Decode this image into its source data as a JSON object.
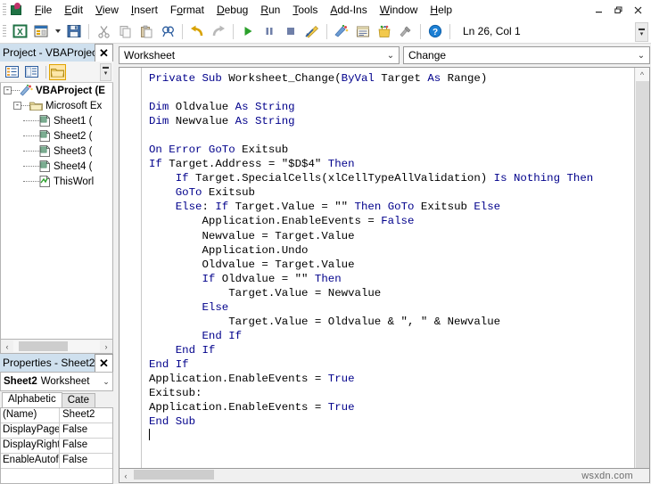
{
  "app": {
    "logo_icon": "excel-vba-logo-icon",
    "window_controls": {
      "minimize": "–",
      "restore": "❐",
      "close": "✕"
    }
  },
  "menubar": {
    "items": [
      {
        "label": "File",
        "accel": "F"
      },
      {
        "label": "Edit",
        "accel": "E"
      },
      {
        "label": "View",
        "accel": "V"
      },
      {
        "label": "Insert",
        "accel": "I"
      },
      {
        "label": "Format",
        "accel": "o"
      },
      {
        "label": "Debug",
        "accel": "D"
      },
      {
        "label": "Run",
        "accel": "R"
      },
      {
        "label": "Tools",
        "accel": "T"
      },
      {
        "label": "Add-Ins",
        "accel": "A"
      },
      {
        "label": "Window",
        "accel": "W"
      },
      {
        "label": "Help",
        "accel": "H"
      }
    ]
  },
  "toolbar": {
    "buttons": [
      {
        "name": "view-excel-icon",
        "title": "View Microsoft Excel"
      },
      {
        "name": "insert-userform-icon",
        "title": "Insert UserForm"
      },
      {
        "name": "save-icon",
        "title": "Save"
      },
      {
        "name": "cut-icon",
        "title": "Cut"
      },
      {
        "name": "copy-icon",
        "title": "Copy"
      },
      {
        "name": "paste-icon",
        "title": "Paste"
      },
      {
        "name": "find-icon",
        "title": "Find"
      },
      {
        "name": "undo-icon",
        "title": "Undo"
      },
      {
        "name": "redo-icon",
        "title": "Redo"
      },
      {
        "name": "run-icon",
        "title": "Run Sub/UserForm"
      },
      {
        "name": "break-icon",
        "title": "Break"
      },
      {
        "name": "reset-icon",
        "title": "Reset"
      },
      {
        "name": "design-mode-icon",
        "title": "Design Mode"
      },
      {
        "name": "project-explorer-icon",
        "title": "Project Explorer"
      },
      {
        "name": "properties-window-icon",
        "title": "Properties Window"
      },
      {
        "name": "object-browser-icon",
        "title": "Object Browser"
      },
      {
        "name": "toolbox-icon",
        "title": "Toolbox"
      },
      {
        "name": "help-icon",
        "title": "Microsoft Visual Basic for Applications Help"
      }
    ],
    "position_status": "Ln 26, Col 1"
  },
  "project_explorer": {
    "title": "Project - VBAProjec",
    "close_label": "✕",
    "toolbar": [
      {
        "name": "view-code-icon"
      },
      {
        "name": "view-object-icon"
      },
      {
        "name": "toggle-folders-icon"
      }
    ],
    "tree": [
      {
        "level": 0,
        "icon": "vbaproject-icon",
        "label": "VBAProject (E",
        "bold": true,
        "expander": "-"
      },
      {
        "level": 1,
        "icon": "folder-icon",
        "label": "Microsoft Ex",
        "bold": false,
        "expander": "-"
      },
      {
        "level": 2,
        "icon": "worksheet-icon",
        "label": "Sheet1 (",
        "bold": false,
        "expander": ""
      },
      {
        "level": 2,
        "icon": "worksheet-icon",
        "label": "Sheet2 (",
        "bold": false,
        "expander": ""
      },
      {
        "level": 2,
        "icon": "worksheet-icon",
        "label": "Sheet3 (",
        "bold": false,
        "expander": ""
      },
      {
        "level": 2,
        "icon": "worksheet-icon",
        "label": "Sheet4 (",
        "bold": false,
        "expander": ""
      },
      {
        "level": 2,
        "icon": "thisworkbook-icon",
        "label": "ThisWorl",
        "bold": false,
        "expander": ""
      }
    ],
    "hscroll": {
      "left_arrow": "‹",
      "right_arrow": "›"
    }
  },
  "properties_panel": {
    "title": "Properties - Sheet2",
    "close_label": "✕",
    "object_name": "Sheet2",
    "object_type": "Worksheet",
    "combo_arrow": "⌄",
    "tabs": [
      {
        "label": "Alphabetic",
        "selected": true
      },
      {
        "label": "Cate",
        "selected": false
      }
    ],
    "rows": [
      {
        "name": "(Name)",
        "value": "Sheet2"
      },
      {
        "name": "DisplayPage",
        "value": "False"
      },
      {
        "name": "DisplayRight",
        "value": "False"
      },
      {
        "name": "EnableAutof",
        "value": "False"
      }
    ]
  },
  "code_window": {
    "object_combo": "Worksheet",
    "procedure_combo": "Change",
    "combo_arrow": "⌄",
    "scroll_up_arrow": "^",
    "scroll_down_arrow": "v",
    "code_lines": [
      {
        "indent": 0,
        "tokens": [
          {
            "t": "Private",
            "k": true
          },
          {
            "t": " ",
            "k": false
          },
          {
            "t": "Sub",
            "k": true
          },
          {
            "t": " Worksheet_Change(",
            "k": false
          },
          {
            "t": "ByVal",
            "k": true
          },
          {
            "t": " Target ",
            "k": false
          },
          {
            "t": "As",
            "k": true
          },
          {
            "t": " Range)",
            "k": false
          }
        ]
      },
      {
        "indent": 0,
        "tokens": []
      },
      {
        "indent": 0,
        "tokens": [
          {
            "t": "Dim",
            "k": true
          },
          {
            "t": " Oldvalue ",
            "k": false
          },
          {
            "t": "As",
            "k": true
          },
          {
            "t": " ",
            "k": false
          },
          {
            "t": "String",
            "k": true
          }
        ]
      },
      {
        "indent": 0,
        "tokens": [
          {
            "t": "Dim",
            "k": true
          },
          {
            "t": " Newvalue ",
            "k": false
          },
          {
            "t": "As",
            "k": true
          },
          {
            "t": " ",
            "k": false
          },
          {
            "t": "String",
            "k": true
          }
        ]
      },
      {
        "indent": 0,
        "tokens": []
      },
      {
        "indent": 0,
        "tokens": [
          {
            "t": "On Error GoTo",
            "k": true
          },
          {
            "t": " Exitsub",
            "k": false
          }
        ]
      },
      {
        "indent": 0,
        "tokens": [
          {
            "t": "If",
            "k": true
          },
          {
            "t": " Target.Address = ",
            "k": false
          },
          {
            "t": "\"$D$4\"",
            "k": false
          },
          {
            "t": " ",
            "k": false
          },
          {
            "t": "Then",
            "k": true
          }
        ]
      },
      {
        "indent": 4,
        "tokens": [
          {
            "t": "If",
            "k": true
          },
          {
            "t": " Target.SpecialCells(",
            "k": false
          },
          {
            "t": "xlCellTypeAllValidation",
            "k": false
          },
          {
            "t": ") ",
            "k": false
          },
          {
            "t": "Is Nothing Then",
            "k": true
          }
        ]
      },
      {
        "indent": 4,
        "tokens": [
          {
            "t": "GoTo",
            "k": true
          },
          {
            "t": " Exitsub",
            "k": false
          }
        ]
      },
      {
        "indent": 4,
        "tokens": [
          {
            "t": "Else",
            "k": true
          },
          {
            "t": ": ",
            "k": false
          },
          {
            "t": "If",
            "k": true
          },
          {
            "t": " Target.Value = ",
            "k": false
          },
          {
            "t": "\"\"",
            "k": false
          },
          {
            "t": " ",
            "k": false
          },
          {
            "t": "Then GoTo",
            "k": true
          },
          {
            "t": " Exitsub ",
            "k": false
          },
          {
            "t": "Else",
            "k": true
          }
        ]
      },
      {
        "indent": 8,
        "tokens": [
          {
            "t": "Application.EnableEvents = ",
            "k": false
          },
          {
            "t": "False",
            "k": true
          }
        ]
      },
      {
        "indent": 8,
        "tokens": [
          {
            "t": "Newvalue = Target.Value",
            "k": false
          }
        ]
      },
      {
        "indent": 8,
        "tokens": [
          {
            "t": "Application.Undo",
            "k": false
          }
        ]
      },
      {
        "indent": 8,
        "tokens": [
          {
            "t": "Oldvalue = Target.Value",
            "k": false
          }
        ]
      },
      {
        "indent": 8,
        "tokens": [
          {
            "t": "If",
            "k": true
          },
          {
            "t": " Oldvalue = ",
            "k": false
          },
          {
            "t": "\"\"",
            "k": false
          },
          {
            "t": " ",
            "k": false
          },
          {
            "t": "Then",
            "k": true
          }
        ]
      },
      {
        "indent": 12,
        "tokens": [
          {
            "t": "Target.Value = Newvalue",
            "k": false
          }
        ]
      },
      {
        "indent": 8,
        "tokens": [
          {
            "t": "Else",
            "k": true
          }
        ]
      },
      {
        "indent": 12,
        "tokens": [
          {
            "t": "Target.Value = Oldvalue & ",
            "k": false
          },
          {
            "t": "\", \"",
            "k": false
          },
          {
            "t": " & Newvalue",
            "k": false
          }
        ]
      },
      {
        "indent": 8,
        "tokens": [
          {
            "t": "End If",
            "k": true
          }
        ]
      },
      {
        "indent": 4,
        "tokens": [
          {
            "t": "End If",
            "k": true
          }
        ]
      },
      {
        "indent": 0,
        "tokens": [
          {
            "t": "End If",
            "k": true
          }
        ]
      },
      {
        "indent": 0,
        "tokens": [
          {
            "t": "Application.EnableEvents = ",
            "k": false
          },
          {
            "t": "True",
            "k": true
          }
        ]
      },
      {
        "indent": 0,
        "tokens": [
          {
            "t": "Exitsub:",
            "k": false
          }
        ]
      },
      {
        "indent": 0,
        "tokens": [
          {
            "t": "Application.EnableEvents = ",
            "k": false
          },
          {
            "t": "True",
            "k": true
          }
        ]
      },
      {
        "indent": 0,
        "tokens": [
          {
            "t": "End Sub",
            "k": true
          }
        ]
      }
    ]
  },
  "watermark": "wsxdn.com",
  "colors": {
    "keyword": "#00008b",
    "panel_title_bg": "#cfe0ee",
    "chrome_bg": "#f0f0f0",
    "code_bg": "#ffffff"
  }
}
